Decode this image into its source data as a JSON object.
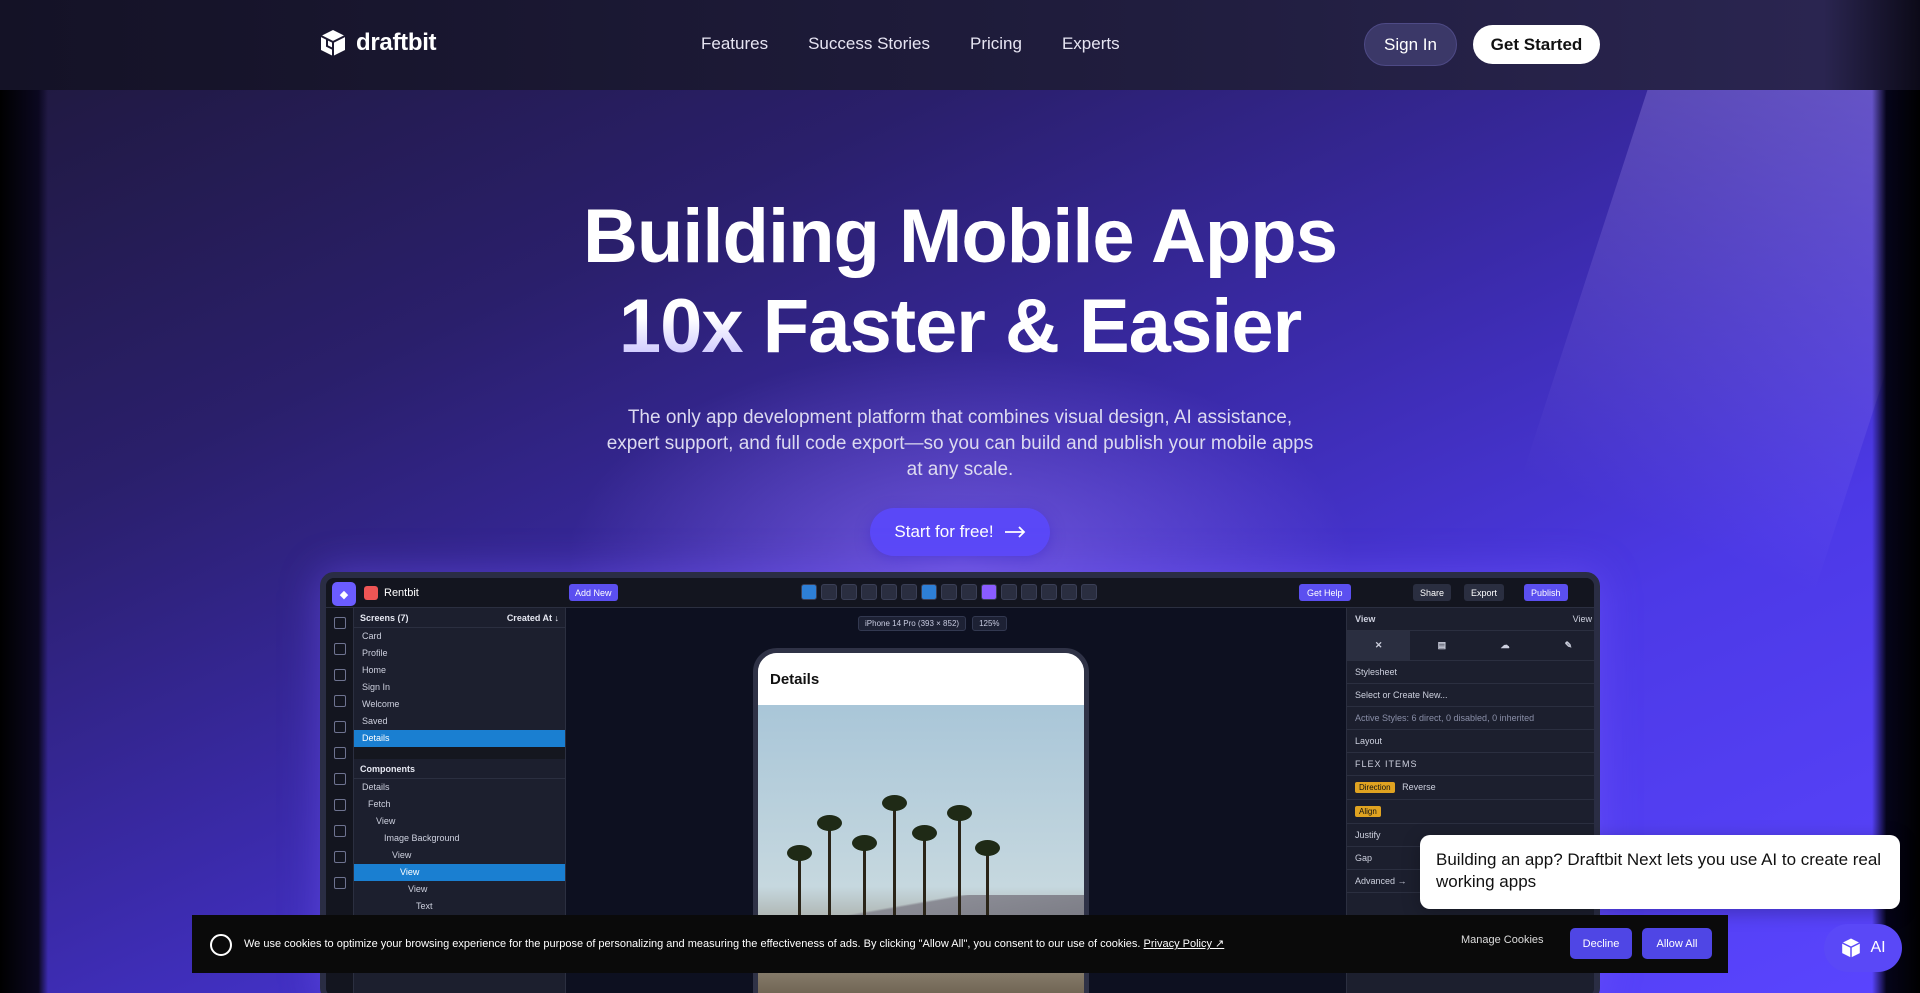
{
  "header": {
    "logo_text": "draftbit",
    "nav": [
      "Features",
      "Success Stories",
      "Pricing",
      "Experts"
    ],
    "sign_in": "Sign In",
    "get_started": "Get Started"
  },
  "hero": {
    "line1": "Building Mobile Apps",
    "line2_emph": "10x",
    "line2_rest": " Faster & Easier",
    "subtitle": "The only app development platform that combines visual design, AI assistance, expert support, and full code export—so you can build and publish your mobile apps at any scale.",
    "cta": "Start for free!",
    "cta_icon": "arrow-right-icon"
  },
  "app": {
    "project": "Rentbit",
    "add_new": "Add New",
    "get_help": "Get Help",
    "share": "Share",
    "export": "Export",
    "publish": "Publish",
    "device": "iPhone 14 Pro (393 × 852)",
    "zoom": "125%",
    "screens_title": "Screens (7)",
    "screens_filter": "Created At ↓",
    "screens": [
      "Card",
      "Profile",
      "Home",
      "Sign In",
      "Welcome",
      "Saved",
      "Details"
    ],
    "components_title": "Components",
    "components": [
      "Details",
      "Fetch",
      "View",
      "Image Background",
      "View",
      "View",
      "View",
      "Text"
    ],
    "phone_title": "Details",
    "right_title": "View",
    "right_view": "View",
    "stylesheet": "Stylesheet",
    "select_style": "Select or Create New...",
    "active_styles": "Active Styles: 6 direct, 0 disabled, 0 inherited",
    "layout": "Layout",
    "flex_items": "FLEX ITEMS",
    "direction": "Direction",
    "reverse": "Reverse",
    "align": "Align",
    "justify": "Justify",
    "gap": "Gap",
    "advanced": "Advanced →"
  },
  "cookie": {
    "text": "We use cookies to optimize your browsing experience for the purpose of personalizing and measuring the effectiveness of ads. By clicking \"Allow All\", you consent to our use of cookies.",
    "policy": "Privacy Policy ↗",
    "manage": "Manage Cookies",
    "decline": "Decline",
    "allow": "Allow All"
  },
  "chat": {
    "message": " Building an app? Draftbit Next lets you use AI to create real working apps",
    "ai_label": "AI"
  }
}
